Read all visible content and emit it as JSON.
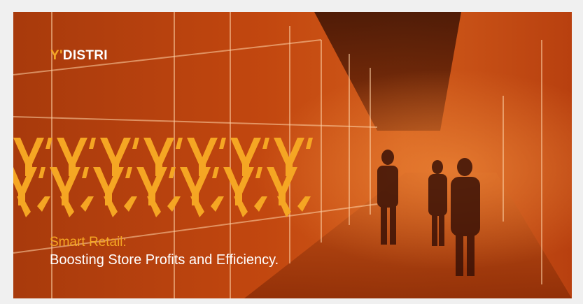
{
  "banner": {
    "logo": {
      "mark": "Y'",
      "text": "DISTRI"
    },
    "headline": {
      "line1": "Smart Retail:",
      "line2": "Boosting Store Profits and Efficiency."
    }
  },
  "colors": {
    "accent": "#f5a623",
    "text": "#ffffff",
    "background": "#8a2a06"
  }
}
